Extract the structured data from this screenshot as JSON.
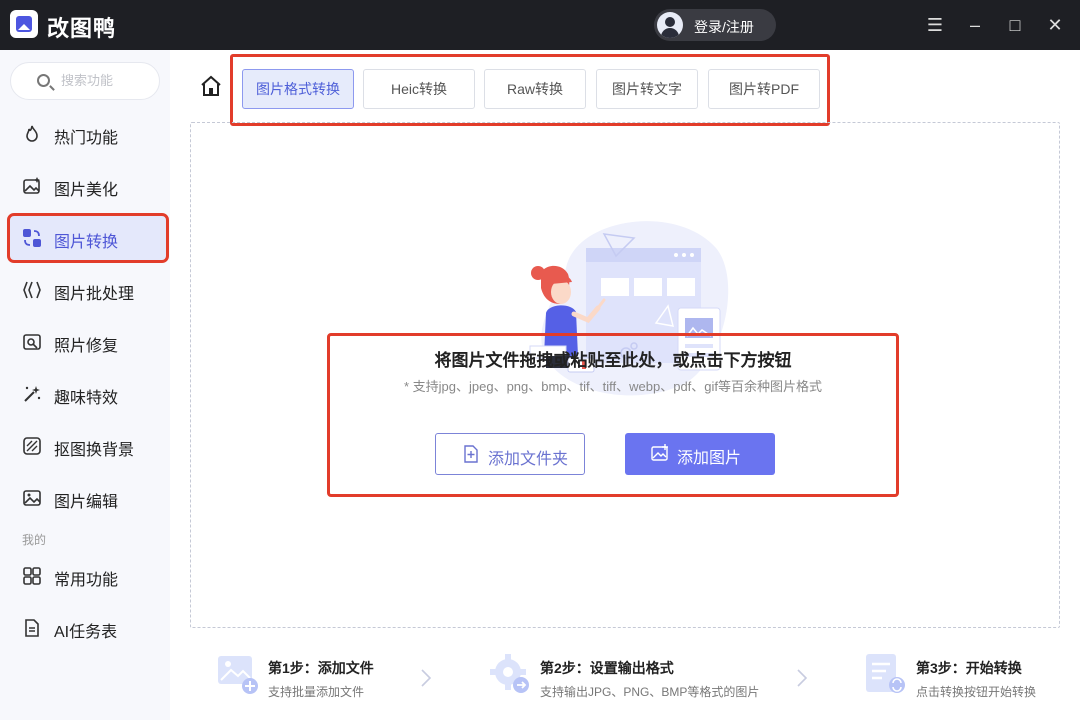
{
  "app": {
    "title": "改图鸭",
    "login_label": "登录/注册"
  },
  "window_controls": {
    "menu": "☰",
    "minimize": "–",
    "maximize": "□",
    "close": "✕"
  },
  "sidebar": {
    "search_placeholder": "搜索功能",
    "items": [
      {
        "label": "热门功能",
        "icon": "fire-icon"
      },
      {
        "label": "图片美化",
        "icon": "image-sparkle-icon"
      },
      {
        "label": "图片转换",
        "icon": "convert-icon",
        "active": true
      },
      {
        "label": "图片批处理",
        "icon": "batch-icon"
      },
      {
        "label": "照片修复",
        "icon": "repair-icon"
      },
      {
        "label": "趣味特效",
        "icon": "magic-wand-icon"
      },
      {
        "label": "抠图换背景",
        "icon": "cutout-icon"
      },
      {
        "label": "图片编辑",
        "icon": "edit-image-icon"
      }
    ],
    "section_label": "我的",
    "my_items": [
      {
        "label": "常用功能",
        "icon": "grid-icon"
      },
      {
        "label": "AI任务表",
        "icon": "document-icon"
      }
    ]
  },
  "tabs": [
    {
      "label": "图片格式转换",
      "active": true
    },
    {
      "label": "Heic转换"
    },
    {
      "label": "Raw转换"
    },
    {
      "label": "图片转文字"
    },
    {
      "label": "图片转PDF"
    }
  ],
  "drop": {
    "title": "将图片文件拖拽或粘贴至此处，或点击下方按钮",
    "subtitle": "* 支持jpg、jpeg、png、bmp、tif、tiff、webp、pdf、gif等百余种图片格式",
    "add_folder": "添加文件夹",
    "add_image": "添加图片"
  },
  "steps": [
    {
      "title": "第1步：添加文件",
      "desc": "支持批量添加文件"
    },
    {
      "title": "第2步：设置输出格式",
      "desc": "支持输出JPG、PNG、BMP等格式的图片"
    },
    {
      "title": "第3步：开始转换",
      "desc": "点击转换按钮开始转换"
    }
  ],
  "colors": {
    "accent": "#6a74f0",
    "highlight_border": "#e23c2a",
    "titlebar": "#1e1f24"
  }
}
